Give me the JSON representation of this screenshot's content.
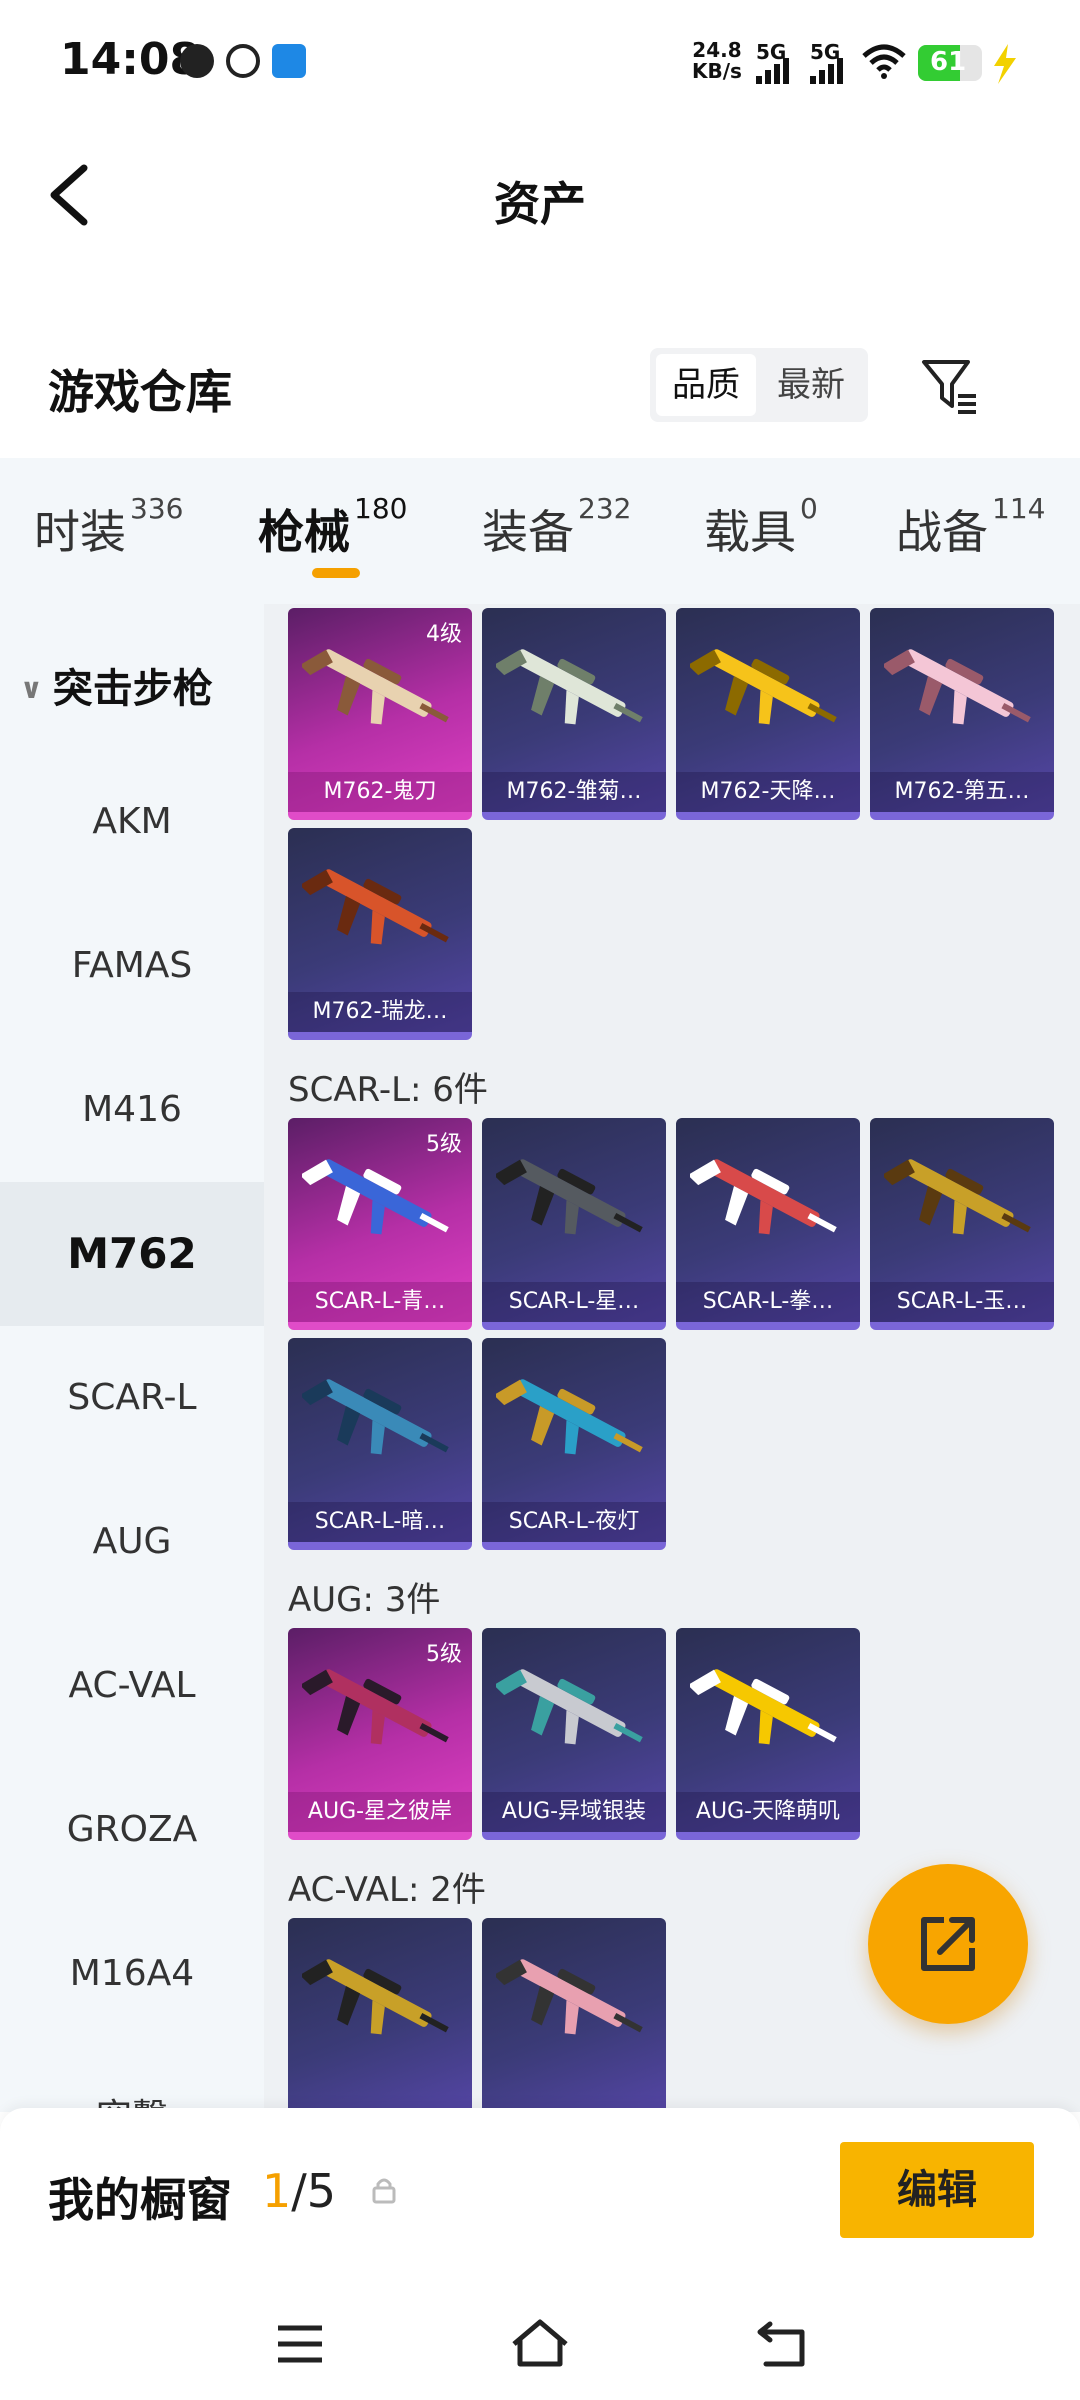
{
  "status_bar": {
    "time": "14:08",
    "net_speed_value": "24.8",
    "net_speed_unit": "KB/s",
    "sim1": "5G",
    "sim2": "5G",
    "battery": "61"
  },
  "header": {
    "title": "资产"
  },
  "section": {
    "title": "游戏仓库",
    "sort_options": [
      "品质",
      "最新"
    ],
    "sort_selected": "品质"
  },
  "tabs": [
    {
      "label": "时装",
      "count": "336"
    },
    {
      "label": "枪械",
      "count": "180"
    },
    {
      "label": "装备",
      "count": "232"
    },
    {
      "label": "载具",
      "count": "0"
    },
    {
      "label": "战备",
      "count": "114"
    }
  ],
  "sidebar": {
    "category": "突击步枪",
    "items": [
      "AKM",
      "FAMAS",
      "M416",
      "M762",
      "SCAR-L",
      "AUG",
      "AC-VAL",
      "GROZA",
      "M16A4",
      "突撃"
    ],
    "selected": "M762"
  },
  "groups": [
    {
      "label": "",
      "items": [
        {
          "name": "M762-鬼刀",
          "level": "4级",
          "quality": "pink"
        },
        {
          "name": "M762-雏菊…",
          "level": "",
          "quality": "purple"
        },
        {
          "name": "M762-天降…",
          "level": "",
          "quality": "purple"
        },
        {
          "name": "M762-第五…",
          "level": "",
          "quality": "purple"
        },
        {
          "name": "M762-瑞龙…",
          "level": "",
          "quality": "purple"
        }
      ]
    },
    {
      "label": "SCAR-L: 6件",
      "items": [
        {
          "name": "SCAR-L-青…",
          "level": "5级",
          "quality": "pink"
        },
        {
          "name": "SCAR-L-星…",
          "level": "",
          "quality": "purple"
        },
        {
          "name": "SCAR-L-拳…",
          "level": "",
          "quality": "purple"
        },
        {
          "name": "SCAR-L-玉…",
          "level": "",
          "quality": "purple"
        },
        {
          "name": "SCAR-L-暗…",
          "level": "",
          "quality": "purple"
        },
        {
          "name": "SCAR-L-夜灯",
          "level": "",
          "quality": "purple"
        }
      ]
    },
    {
      "label": "AUG: 3件",
      "items": [
        {
          "name": "AUG-星之彼岸",
          "level": "5级",
          "quality": "pink"
        },
        {
          "name": "AUG-异域银装",
          "level": "",
          "quality": "purple"
        },
        {
          "name": "AUG-天降萌叽",
          "level": "",
          "quality": "purple"
        }
      ]
    },
    {
      "label": "AC-VAL: 2件",
      "items": [
        {
          "name": "",
          "level": "",
          "quality": "purple"
        },
        {
          "name": "",
          "level": "",
          "quality": "purple"
        }
      ]
    }
  ],
  "showcase": {
    "label": "我的橱窗",
    "current": "1",
    "total": "/5",
    "edit_label": "编辑"
  },
  "colors": {
    "accent": "#f5a000",
    "card_pink": "#e040c4",
    "card_purple": "#5646a8"
  }
}
